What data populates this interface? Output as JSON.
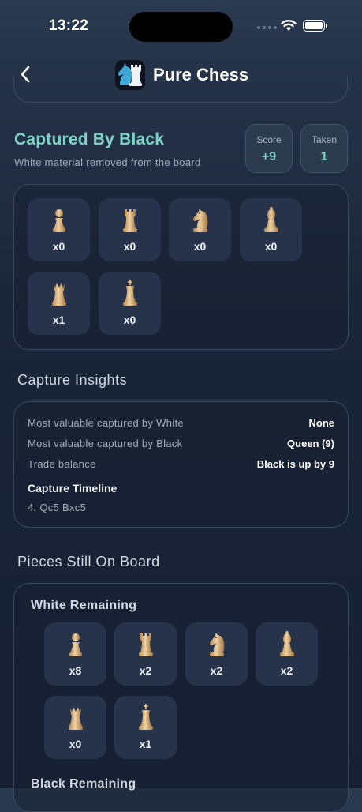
{
  "status": {
    "time": "13:22"
  },
  "header": {
    "title": "Pure Chess"
  },
  "captured": {
    "title": "Captured By Black",
    "subtitle": "White material removed from the board",
    "score_label": "Score",
    "score_value": "+9",
    "taken_label": "Taken",
    "taken_value": "1",
    "pieces": [
      {
        "icon": "white-pawn-icon",
        "count": "x0"
      },
      {
        "icon": "white-rook-icon",
        "count": "x0"
      },
      {
        "icon": "white-knight-icon",
        "count": "x0"
      },
      {
        "icon": "white-bishop-icon",
        "count": "x0"
      },
      {
        "icon": "white-queen-icon",
        "count": "x1"
      },
      {
        "icon": "white-king-icon",
        "count": "x0"
      }
    ]
  },
  "insights": {
    "title": "Capture Insights",
    "rows": [
      {
        "label": "Most valuable captured by White",
        "value": "None"
      },
      {
        "label": "Most valuable captured by Black",
        "value": "Queen (9)"
      },
      {
        "label": "Trade balance",
        "value": "Black is up by 9"
      }
    ],
    "timeline_title": "Capture Timeline",
    "timeline": "4. Qc5 Bxc5"
  },
  "remaining": {
    "title": "Pieces Still On Board",
    "white_title": "White Remaining",
    "white": [
      {
        "icon": "white-pawn-icon",
        "count": "x8"
      },
      {
        "icon": "white-rook-icon",
        "count": "x2"
      },
      {
        "icon": "white-knight-icon",
        "count": "x2"
      },
      {
        "icon": "white-bishop-icon",
        "count": "x2"
      },
      {
        "icon": "white-queen-icon",
        "count": "x0"
      },
      {
        "icon": "white-king-icon",
        "count": "x1"
      }
    ],
    "black_title": "Black Remaining"
  },
  "colors": {
    "accent": "#7fd3c6",
    "background": "#1b2538",
    "tile": "#26334a",
    "piece": "#d9b27c"
  }
}
